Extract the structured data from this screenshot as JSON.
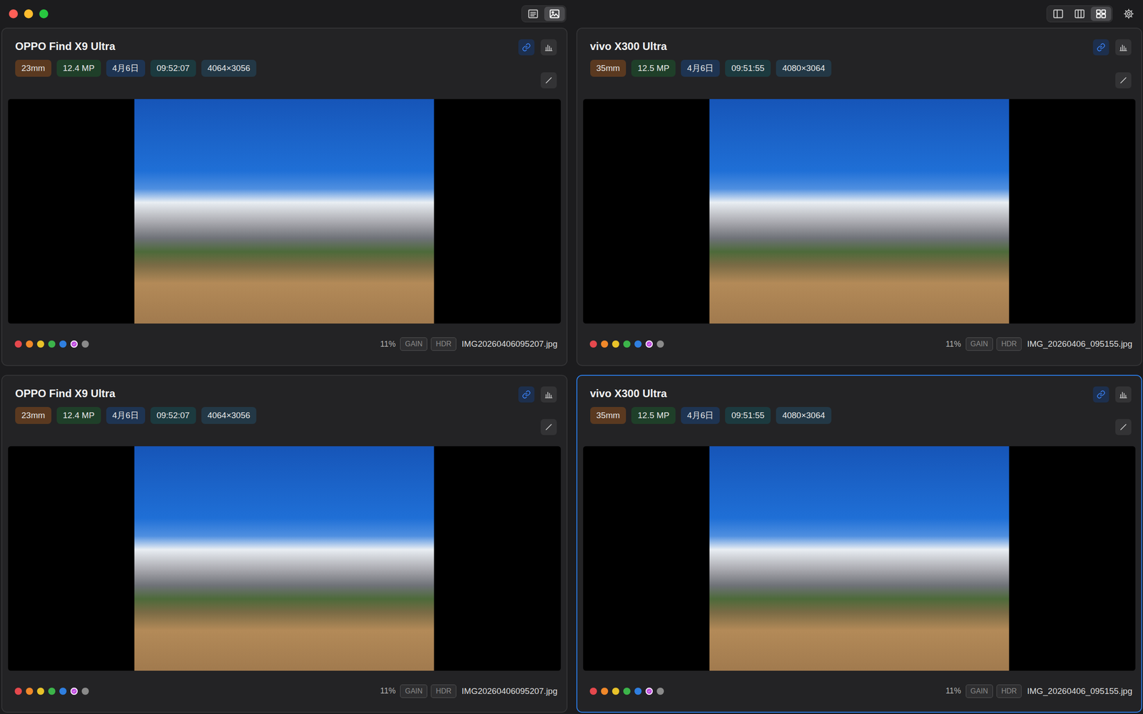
{
  "toolbar": {
    "view_modes": [
      {
        "kind": "list",
        "selected": false
      },
      {
        "kind": "image",
        "selected": true
      }
    ],
    "layouts": [
      {
        "kind": "single",
        "selected": false
      },
      {
        "kind": "columns",
        "selected": false
      },
      {
        "kind": "grid",
        "selected": true
      }
    ]
  },
  "panels": [
    {
      "title": "OPPO Find X9 Ultra",
      "linked": true,
      "selected": false,
      "chips": [
        {
          "text": "23mm",
          "color": "#5a3920"
        },
        {
          "text": "12.4 MP",
          "color": "#1f3f29"
        },
        {
          "text": "4月6日",
          "color": "#1e3452"
        },
        {
          "text": "09:52:07",
          "color": "#1c3a3f"
        },
        {
          "text": "4064×3056",
          "color": "#233846"
        }
      ],
      "labels": [
        {
          "color": "#e5484d",
          "selected": false
        },
        {
          "color": "#f0882a",
          "selected": false
        },
        {
          "color": "#e8c22a",
          "selected": false
        },
        {
          "color": "#3cb44a",
          "selected": false
        },
        {
          "color": "#2f7fe0",
          "selected": false
        },
        {
          "color": "#c04ce0",
          "selected": true
        },
        {
          "color": "#8a8a8a",
          "selected": false
        }
      ],
      "zoom": "11%",
      "badges": [
        {
          "text": "GAIN",
          "on": false
        },
        {
          "text": "HDR",
          "on": false
        }
      ],
      "filename": "IMG20260406095207.jpg"
    },
    {
      "title": "vivo X300 Ultra",
      "linked": true,
      "selected": false,
      "chips": [
        {
          "text": "35mm",
          "color": "#5a3920"
        },
        {
          "text": "12.5 MP",
          "color": "#1f3f29"
        },
        {
          "text": "4月6日",
          "color": "#1e3452"
        },
        {
          "text": "09:51:55",
          "color": "#1c3a3f"
        },
        {
          "text": "4080×3064",
          "color": "#233846"
        }
      ],
      "labels": [
        {
          "color": "#e5484d",
          "selected": false
        },
        {
          "color": "#f0882a",
          "selected": false
        },
        {
          "color": "#e8c22a",
          "selected": false
        },
        {
          "color": "#3cb44a",
          "selected": false
        },
        {
          "color": "#2f7fe0",
          "selected": false
        },
        {
          "color": "#c04ce0",
          "selected": true
        },
        {
          "color": "#8a8a8a",
          "selected": false
        }
      ],
      "zoom": "11%",
      "badges": [
        {
          "text": "GAIN",
          "on": false
        },
        {
          "text": "HDR",
          "on": false
        }
      ],
      "filename": "IMG_20260406_095155.jpg"
    },
    {
      "title": "OPPO Find X9 Ultra",
      "linked": true,
      "selected": false,
      "chips": [
        {
          "text": "23mm",
          "color": "#5a3920"
        },
        {
          "text": "12.4 MP",
          "color": "#1f3f29"
        },
        {
          "text": "4月6日",
          "color": "#1e3452"
        },
        {
          "text": "09:52:07",
          "color": "#1c3a3f"
        },
        {
          "text": "4064×3056",
          "color": "#233846"
        }
      ],
      "labels": [
        {
          "color": "#e5484d",
          "selected": false
        },
        {
          "color": "#f0882a",
          "selected": false
        },
        {
          "color": "#e8c22a",
          "selected": false
        },
        {
          "color": "#3cb44a",
          "selected": false
        },
        {
          "color": "#2f7fe0",
          "selected": false
        },
        {
          "color": "#c04ce0",
          "selected": true
        },
        {
          "color": "#8a8a8a",
          "selected": false
        }
      ],
      "zoom": "11%",
      "badges": [
        {
          "text": "GAIN",
          "on": false
        },
        {
          "text": "HDR",
          "on": false
        }
      ],
      "filename": "IMG20260406095207.jpg"
    },
    {
      "title": "vivo X300 Ultra",
      "linked": true,
      "selected": true,
      "chips": [
        {
          "text": "35mm",
          "color": "#5a3920"
        },
        {
          "text": "12.5 MP",
          "color": "#1f3f29"
        },
        {
          "text": "4月6日",
          "color": "#1e3452"
        },
        {
          "text": "09:51:55",
          "color": "#1c3a3f"
        },
        {
          "text": "4080×3064",
          "color": "#233846"
        }
      ],
      "labels": [
        {
          "color": "#e5484d",
          "selected": false
        },
        {
          "color": "#f0882a",
          "selected": false
        },
        {
          "color": "#e8c22a",
          "selected": false
        },
        {
          "color": "#3cb44a",
          "selected": false
        },
        {
          "color": "#2f7fe0",
          "selected": false
        },
        {
          "color": "#c04ce0",
          "selected": true
        },
        {
          "color": "#8a8a8a",
          "selected": false
        }
      ],
      "zoom": "11%",
      "badges": [
        {
          "text": "GAIN",
          "on": false
        },
        {
          "text": "HDR",
          "on": false
        }
      ],
      "filename": "IMG_20260406_095155.jpg"
    }
  ]
}
